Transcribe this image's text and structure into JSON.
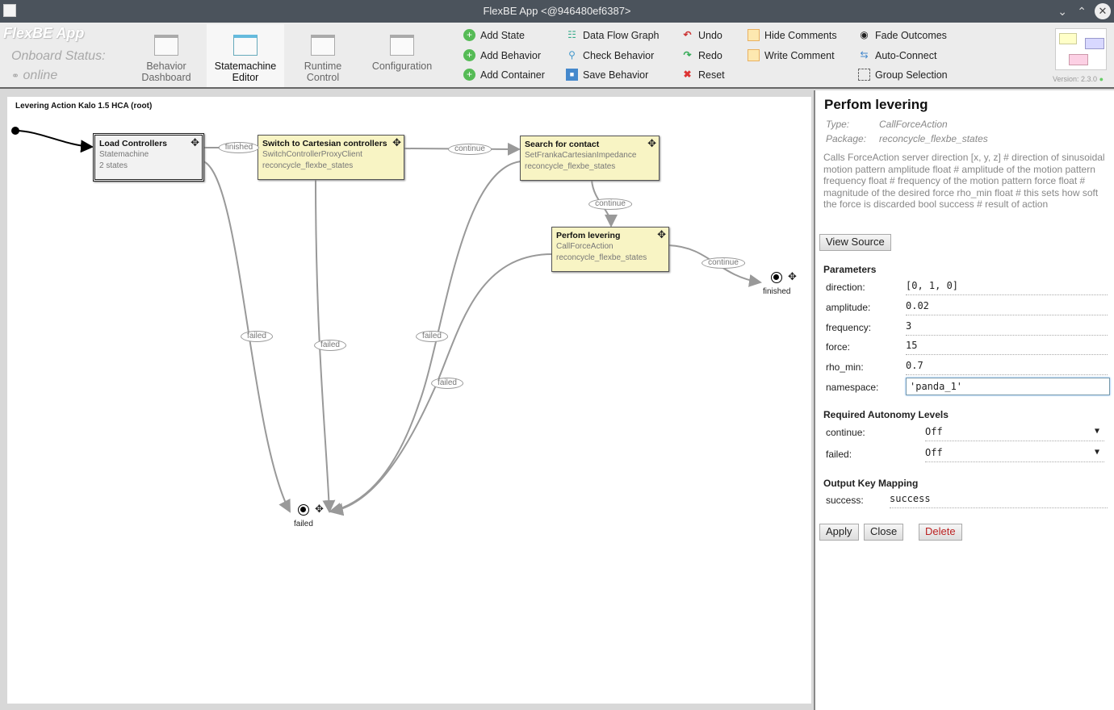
{
  "window": {
    "title": "FlexBE App <@946480ef6387>"
  },
  "toolbar": {
    "brand": "FlexBE App",
    "status_label": "Onboard Status:",
    "status_value": "online",
    "tabs": [
      {
        "label1": "Behavior",
        "label2": "Dashboard"
      },
      {
        "label1": "Statemachine",
        "label2": "Editor"
      },
      {
        "label1": "Runtime",
        "label2": "Control"
      },
      {
        "label1": "Configuration",
        "label2": ""
      }
    ],
    "commands": {
      "add_state": "Add State",
      "add_behavior": "Add Behavior",
      "add_container": "Add Container",
      "data_flow": "Data Flow Graph",
      "check": "Check Behavior",
      "save": "Save Behavior",
      "undo": "Undo",
      "redo": "Redo",
      "reset": "Reset",
      "hide_comments": "Hide Comments",
      "write_comment": "Write Comment",
      "fade": "Fade Outcomes",
      "auto_connect": "Auto-Connect",
      "group": "Group Selection"
    },
    "version": "Version: 2.3.0"
  },
  "canvas": {
    "title": "Levering Action Kalo 1.5 HCA (root)",
    "states": [
      {
        "name": "Load Controllers",
        "line1": "Statemachine",
        "line2": "2 states"
      },
      {
        "name": "Switch to Cartesian controllers",
        "line1": "SwitchControllerProxyClient",
        "line2": "reconcycle_flexbe_states"
      },
      {
        "name": "Search for contact",
        "line1": "SetFrankaCartesianImpedance",
        "line2": "reconcycle_flexbe_states"
      },
      {
        "name": "Perfom levering",
        "line1": "CallForceAction",
        "line2": "reconcycle_flexbe_states"
      }
    ],
    "transitions": [
      "finished",
      "continue",
      "continue",
      "continue",
      "failed",
      "failed",
      "failed",
      "failed"
    ],
    "outcomes": [
      "finished",
      "failed"
    ]
  },
  "panel": {
    "title": "Perfom levering",
    "type_label": "Type:",
    "type": "CallForceAction",
    "package_label": "Package:",
    "package": "reconcycle_flexbe_states",
    "description": "Calls ForceAction server direction [x, y, z] # direction of sinusoidal motion pattern amplitude float # amplitude of the motion pattern frequency float # frequency of the motion pattern force float # magnitude of the desired force rho_min float # this sets how soft the force is discarded bool success # result of action",
    "view_source": "View Source",
    "parameters_title": "Parameters",
    "parameters": [
      {
        "k": "direction:",
        "v": "[0, 1, 0]"
      },
      {
        "k": "amplitude:",
        "v": "0.02"
      },
      {
        "k": "frequency:",
        "v": "3"
      },
      {
        "k": "force:",
        "v": "15"
      },
      {
        "k": "rho_min:",
        "v": "0.7"
      },
      {
        "k": "namespace:",
        "v": "'panda_1'"
      }
    ],
    "autonomy_title": "Required Autonomy Levels",
    "autonomy": [
      {
        "k": "continue:",
        "v": "Off"
      },
      {
        "k": "failed:",
        "v": "Off"
      }
    ],
    "output_title": "Output Key Mapping",
    "outputs": [
      {
        "k": "success:",
        "v": "success"
      }
    ],
    "apply": "Apply",
    "close": "Close",
    "delete": "Delete"
  }
}
